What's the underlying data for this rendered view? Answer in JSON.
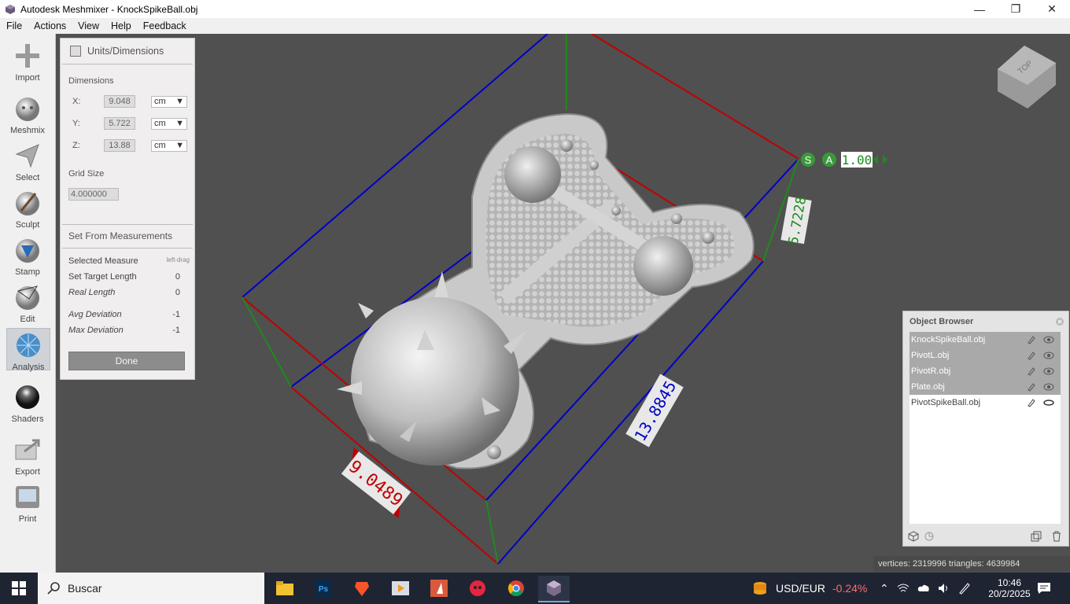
{
  "window": {
    "title": "Autodesk Meshmixer - KnockSpikeBall.obj",
    "minimize": "—",
    "maximize": "❐",
    "close": "✕"
  },
  "menu": [
    "File",
    "Actions",
    "View",
    "Help",
    "Feedback"
  ],
  "tools": [
    {
      "label": "Import",
      "icon": "plus-icon"
    },
    {
      "label": "Meshmix",
      "icon": "bunny-ball-icon"
    },
    {
      "label": "Select",
      "icon": "arrow-select-icon"
    },
    {
      "label": "Sculpt",
      "icon": "brush-icon"
    },
    {
      "label": "Stamp",
      "icon": "stamp-icon"
    },
    {
      "label": "Edit",
      "icon": "edit-sphere-icon"
    },
    {
      "label": "Analysis",
      "icon": "analysis-sphere-icon"
    },
    {
      "label": "Shaders",
      "icon": "shader-sphere-icon"
    },
    {
      "label": "Export",
      "icon": "export-icon"
    },
    {
      "label": "Print",
      "icon": "printer-icon"
    }
  ],
  "units_panel": {
    "title": "Units/Dimensions",
    "dimensions_label": "Dimensions",
    "x_label": "X:",
    "x_value": "9.048",
    "x_unit": "cm",
    "y_label": "Y:",
    "y_value": "5.722",
    "y_unit": "cm",
    "z_label": "Z:",
    "z_value": "13.88",
    "z_unit": "cm",
    "grid_label": "Grid Size",
    "grid_value": "4.000000",
    "measure_header": "Set From Measurements",
    "selected_measure_label": "Selected Measure",
    "selected_measure_value": "left-drag",
    "target_length_label": "Set Target Length",
    "target_length_value": "0",
    "real_length_label": "Real Length",
    "real_length_value": "0",
    "avg_dev_label": "Avg Deviation",
    "avg_dev_value": "-1",
    "max_dev_label": "Max Deviation",
    "max_dev_value": "-1",
    "done_label": "Done"
  },
  "viewport": {
    "dim_x_label": "9.0489",
    "dim_y_label": "5.7228",
    "dim_z_label": "13.8845",
    "scale_s": "S",
    "scale_a": "A",
    "scale_value": "1.00",
    "cube_label": "TOP"
  },
  "object_browser": {
    "title": "Object Browser",
    "objects": [
      {
        "name": "KnockSpikeBall.obj",
        "selected": true
      },
      {
        "name": "PivotL.obj",
        "selected": true
      },
      {
        "name": "PivotR.obj",
        "selected": true
      },
      {
        "name": "Plate.obj",
        "selected": true
      },
      {
        "name": "PivotSpikeBall.obj",
        "selected": false
      }
    ]
  },
  "status": {
    "text": "vertices: 2319996 triangles: 4639984"
  },
  "taskbar": {
    "search_placeholder": "Buscar",
    "currency_label": "USD/EUR",
    "currency_change": "-0.24%",
    "time": "10:46",
    "date": "20/2/2025"
  },
  "colors": {
    "viewport_bg": "#505050",
    "axis_red": "#c00000",
    "axis_blue": "#0000c8",
    "axis_green": "#1e8a1e",
    "taskbar_bg": "#1f2433",
    "negative_change": "#ff6b6b"
  }
}
